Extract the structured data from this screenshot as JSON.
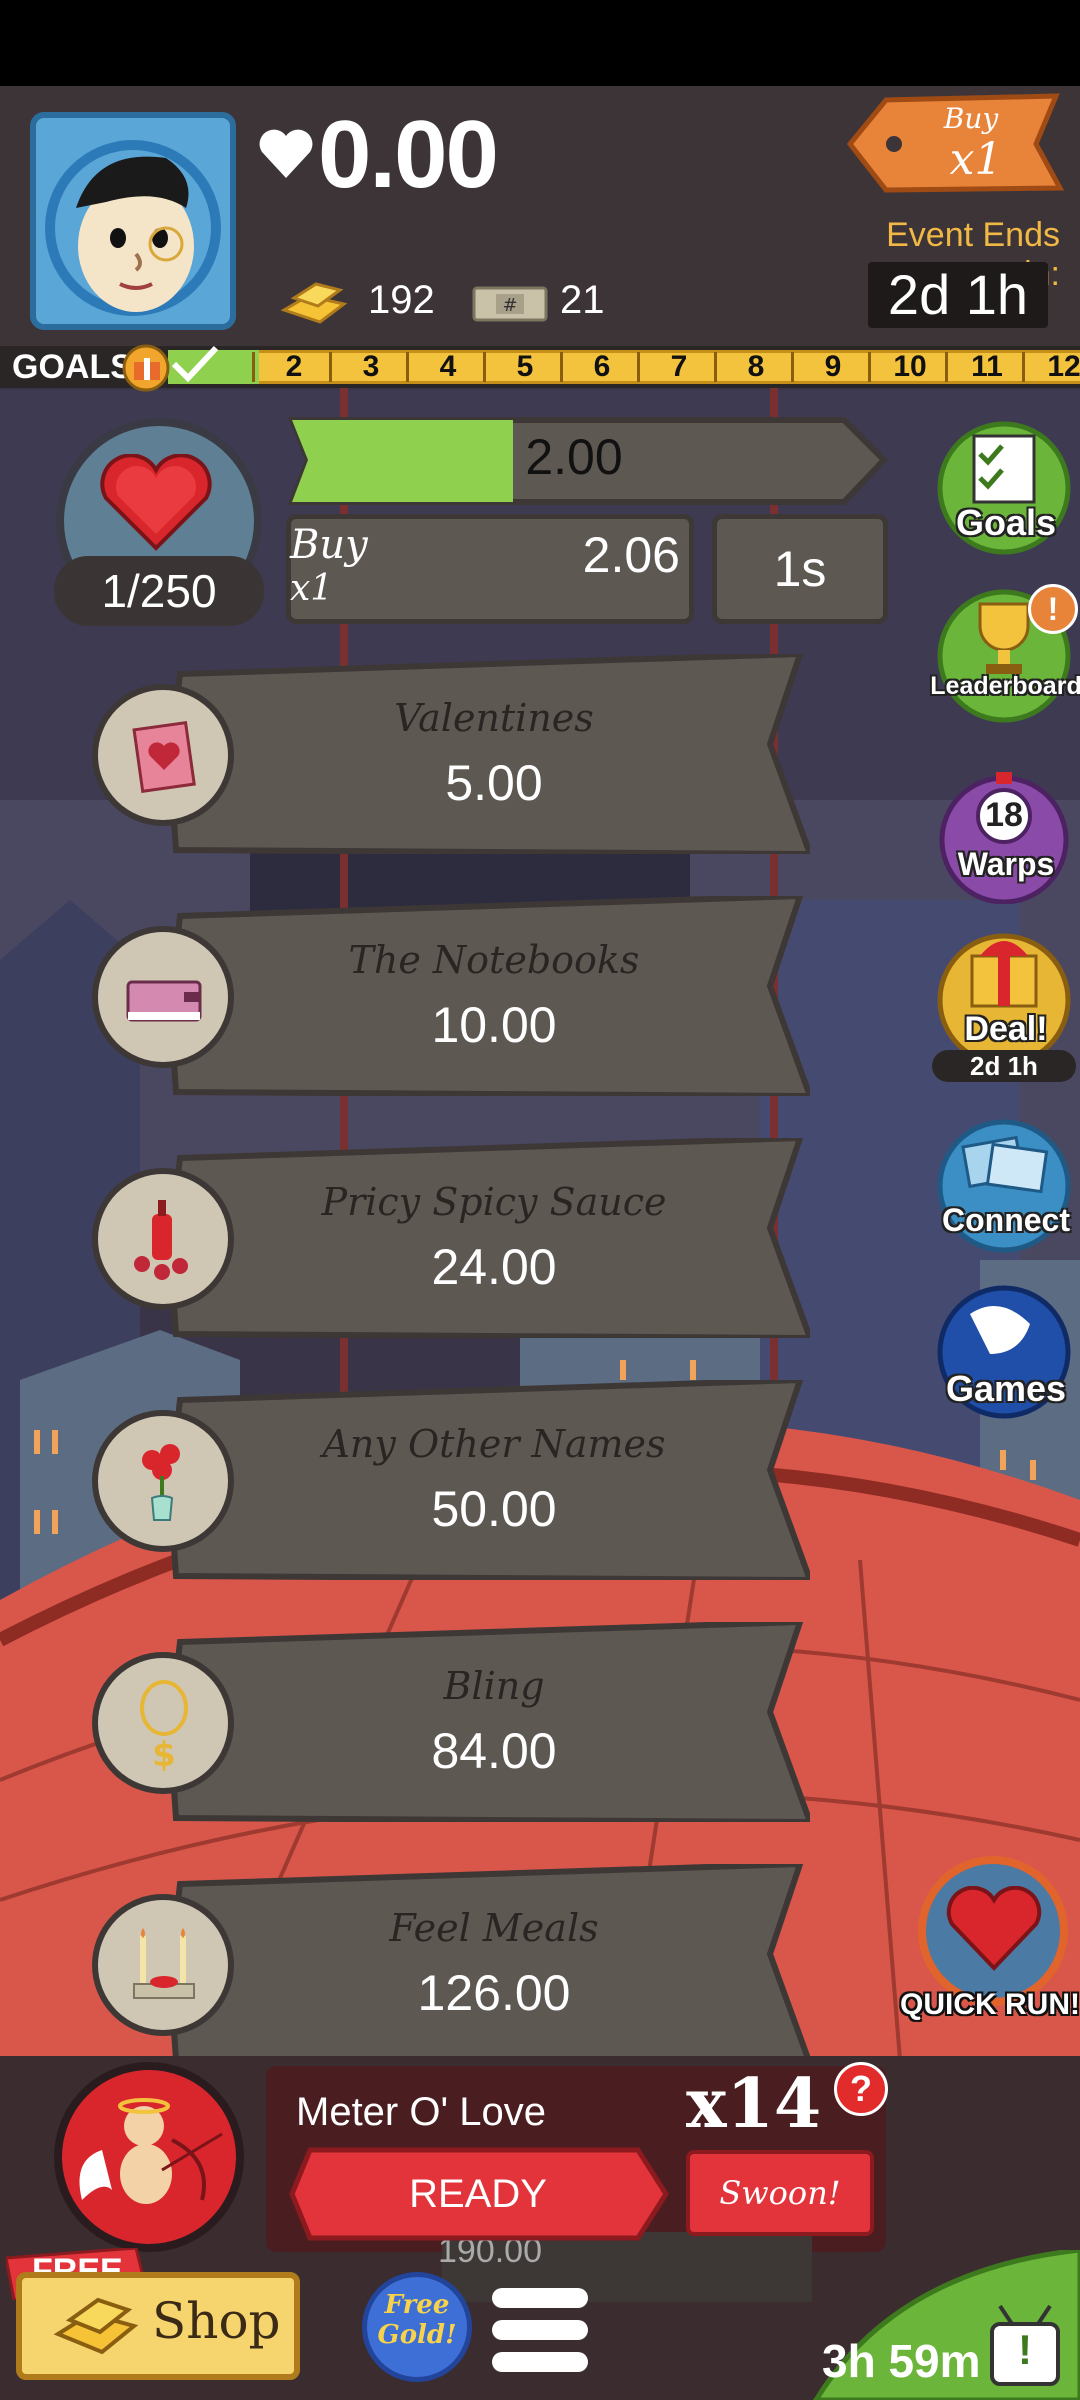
{
  "header": {
    "money": "0.00",
    "gold_count": "192",
    "megabucks_count": "21",
    "buy_tag": {
      "line1": "Buy",
      "line2": "x1"
    },
    "event_label": "Event Ends in:",
    "event_time": "2d 1h"
  },
  "goals": {
    "label": "GOALS",
    "numbers": [
      "2",
      "3",
      "4",
      "5",
      "6",
      "7",
      "8",
      "9",
      "10",
      "11",
      "12"
    ],
    "progress_fraction": 0.1
  },
  "main_business": {
    "count": "1/250",
    "progress_value": "2.00",
    "progress_fraction": 0.4,
    "buy_label": "Buy",
    "buy_mult": "x1",
    "buy_cost": "2.06",
    "timer": "1s"
  },
  "businesses": [
    {
      "name": "Valentines",
      "price": "5.00",
      "icon": "valentine-card-icon"
    },
    {
      "name": "The Notebooks",
      "price": "10.00",
      "icon": "notebook-icon"
    },
    {
      "name": "Pricy Spicy Sauce",
      "price": "24.00",
      "icon": "hot-sauce-icon"
    },
    {
      "name": "Any Other Names",
      "price": "50.00",
      "icon": "rose-vase-icon"
    },
    {
      "name": "Bling",
      "price": "84.00",
      "icon": "necklace-icon"
    },
    {
      "name": "Feel Meals",
      "price": "126.00",
      "icon": "candle-dinner-icon"
    }
  ],
  "sidebar": {
    "goals": "Goals",
    "leaderboard": "Leaderboard",
    "leaderboard_alert": "!",
    "warps": "Warps",
    "warps_count": "18",
    "deal": "Deal!",
    "deal_time": "2d 1h",
    "connect": "Connect",
    "games": "Games"
  },
  "quick_run": {
    "label": "QUICK RUN!"
  },
  "meter": {
    "title": "Meter O' Love",
    "multiplier": "x14",
    "help": "?",
    "ready": "READY",
    "swoon": "Swoon!",
    "hidden_price": "190.00"
  },
  "bottom": {
    "free": "FREE",
    "shop": "Shop",
    "free_gold": "Free Gold!",
    "timer": "3h 59m",
    "alert": "!"
  },
  "colors": {
    "progress_green": "#8fd14f",
    "goals_yellow": "#f3c33d",
    "ready_red": "#e4343b"
  }
}
